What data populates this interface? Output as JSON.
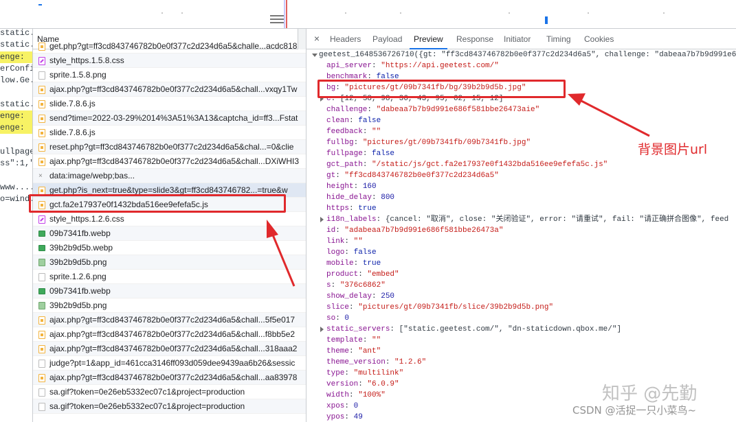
{
  "console": {
    "lines": [
      {
        "text": "static.com/",
        "highlight": false
      },
      {
        "text": "static.ge...",
        "highlight": false
      },
      {
        "text": "enge:",
        "highlight": true
      },
      {
        "text": "erConfi...",
        "highlight": false
      },
      {
        "text": "low.Ge...",
        "highlight": false
      },
      {
        "text": "",
        "highlight": false
      },
      {
        "text": "static.g...",
        "highlight": false
      },
      {
        "text": "enge:",
        "highlight": true
      },
      {
        "text": "enge:",
        "highlight": true
      },
      {
        "text": "",
        "highlight": false
      },
      {
        "text": "ullpage...",
        "highlight": false
      },
      {
        "text": "ss\":1,\"...",
        "highlight": false
      },
      {
        "text": "",
        "highlight": false
      },
      {
        "text": "www....",
        "highlight": false
      },
      {
        "text": "o=wind...",
        "highlight": false
      }
    ]
  },
  "requests": {
    "column_name": "Name",
    "rows": [
      {
        "name": "get.php?gt=ff3cd843746782b0e0f377c2d234d6a5&challe...acdc818",
        "type": "js"
      },
      {
        "name": "style_https.1.5.8.css",
        "type": "css"
      },
      {
        "name": "sprite.1.5.8.png",
        "type": "doc"
      },
      {
        "name": "ajax.php?gt=ff3cd843746782b0e0f377c2d234d6a5&chall...vxqy1Tw",
        "type": "js"
      },
      {
        "name": "slide.7.8.6.js",
        "type": "js"
      },
      {
        "name": "send?time=2022-03-29%2014%3A51%3A13&captcha_id=ff3...Fstat",
        "type": "js"
      },
      {
        "name": "slide.7.8.6.js",
        "type": "js"
      },
      {
        "name": "reset.php?gt=ff3cd843746782b0e0f377c2d234d6a5&chal...=0&clie",
        "type": "js"
      },
      {
        "name": "ajax.php?gt=ff3cd843746782b0e0f377c2d234d6a5&chall...DXiWHI3",
        "type": "js"
      },
      {
        "name": "data:image/webp;bas...",
        "type": "data"
      },
      {
        "name": "get.php?is_next=true&type=slide3&gt=ff3cd843746782...=true&w",
        "type": "js"
      },
      {
        "name": "gct.fa2e17937e0f1432bda516ee9efefa5c.js",
        "type": "js"
      },
      {
        "name": "style_https.1.2.6.css",
        "type": "css"
      },
      {
        "name": "09b7341fb.webp",
        "type": "img"
      },
      {
        "name": "39b2b9d5b.webp",
        "type": "img"
      },
      {
        "name": "39b2b9d5b.png",
        "type": "imgb"
      },
      {
        "name": "sprite.1.2.6.png",
        "type": "doc"
      },
      {
        "name": "09b7341fb.webp",
        "type": "img"
      },
      {
        "name": "39b2b9d5b.png",
        "type": "imgb"
      },
      {
        "name": "ajax.php?gt=ff3cd843746782b0e0f377c2d234d6a5&chall...5f5e017",
        "type": "js"
      },
      {
        "name": "ajax.php?gt=ff3cd843746782b0e0f377c2d234d6a5&chall...f8bb5e2",
        "type": "js"
      },
      {
        "name": "ajax.php?gt=ff3cd843746782b0e0f377c2d234d6a5&chall...318aaa2",
        "type": "js"
      },
      {
        "name": "judge?pt=1&app_id=461cca3146ff093d059dee9439aa6b26&sessic",
        "type": "doc"
      },
      {
        "name": "ajax.php?gt=ff3cd843746782b0e0f377c2d234d6a5&chall...aa83978",
        "type": "js"
      },
      {
        "name": "sa.gif?token=0e26eb5332ec07c1&project=production",
        "type": "doc"
      },
      {
        "name": "sa.gif?token=0e26eb5332ec07c1&project=production",
        "type": "doc"
      }
    ]
  },
  "detail": {
    "close_icon": "×",
    "tabs": [
      "Headers",
      "Payload",
      "Preview",
      "Response",
      "Initiator",
      "Timing",
      "Cookies"
    ],
    "active_tab": "Preview",
    "preview": {
      "root_line": "geetest_1648536726710({gt: \"ff3cd843746782b0e0f377c2d234d6a5\", challenge: \"dabeaa7b7b9d991e6",
      "lines": [
        {
          "key": "api_server",
          "value": "\"https://api.geetest.com/\"",
          "kind": "s",
          "expandable": false
        },
        {
          "key": "benchmark",
          "value": "false",
          "kind": "b",
          "expandable": false
        },
        {
          "key": "bg",
          "value": "\"pictures/gt/09b7341fb/bg/39b2b9d5b.jpg\"",
          "kind": "s",
          "expandable": false
        },
        {
          "key": "c",
          "value": "[12, 58, 98, 36, 43, 95, 62, 15, 12]",
          "kind": "plain",
          "expandable": true
        },
        {
          "key": "challenge",
          "value": "\"dabeaa7b7b9d991e686f581bbe26473aie\"",
          "kind": "s",
          "expandable": false
        },
        {
          "key": "clean",
          "value": "false",
          "kind": "b",
          "expandable": false
        },
        {
          "key": "feedback",
          "value": "\"\"",
          "kind": "s",
          "expandable": false
        },
        {
          "key": "fullbg",
          "value": "\"pictures/gt/09b7341fb/09b7341fb.jpg\"",
          "kind": "s",
          "expandable": false
        },
        {
          "key": "fullpage",
          "value": "false",
          "kind": "b",
          "expandable": false
        },
        {
          "key": "gct_path",
          "value": "\"/static/js/gct.fa2e17937e0f1432bda516ee9efefa5c.js\"",
          "kind": "s",
          "expandable": false
        },
        {
          "key": "gt",
          "value": "\"ff3cd843746782b0e0f377c2d234d6a5\"",
          "kind": "s",
          "expandable": false
        },
        {
          "key": "height",
          "value": "160",
          "kind": "n",
          "expandable": false
        },
        {
          "key": "hide_delay",
          "value": "800",
          "kind": "n",
          "expandable": false
        },
        {
          "key": "https",
          "value": "true",
          "kind": "b",
          "expandable": false
        },
        {
          "key": "i18n_labels",
          "value": "{cancel: \"取消\", close: \"关闭验证\", error: \"请重试\", fail: \"请正确拼合图像\", feed",
          "kind": "plain",
          "expandable": true
        },
        {
          "key": "id",
          "value": "\"adabeaa7b7b9d991e686f581bbe26473a\"",
          "kind": "s",
          "expandable": false
        },
        {
          "key": "link",
          "value": "\"\"",
          "kind": "s",
          "expandable": false
        },
        {
          "key": "logo",
          "value": "false",
          "kind": "b",
          "expandable": false
        },
        {
          "key": "mobile",
          "value": "true",
          "kind": "b",
          "expandable": false
        },
        {
          "key": "product",
          "value": "\"embed\"",
          "kind": "s",
          "expandable": false
        },
        {
          "key": "s",
          "value": "\"376c6862\"",
          "kind": "s",
          "expandable": false
        },
        {
          "key": "show_delay",
          "value": "250",
          "kind": "n",
          "expandable": false
        },
        {
          "key": "slice",
          "value": "\"pictures/gt/09b7341fb/slice/39b2b9d5b.png\"",
          "kind": "s",
          "expandable": false
        },
        {
          "key": "so",
          "value": "0",
          "kind": "n",
          "expandable": false
        },
        {
          "key": "static_servers",
          "value": "[\"static.geetest.com/\", \"dn-staticdown.qbox.me/\"]",
          "kind": "plain",
          "expandable": true
        },
        {
          "key": "template",
          "value": "\"\"",
          "kind": "s",
          "expandable": false
        },
        {
          "key": "theme",
          "value": "\"ant\"",
          "kind": "s",
          "expandable": false
        },
        {
          "key": "theme_version",
          "value": "\"1.2.6\"",
          "kind": "s",
          "expandable": false
        },
        {
          "key": "type",
          "value": "\"multilink\"",
          "kind": "s",
          "expandable": false
        },
        {
          "key": "version",
          "value": "\"6.0.9\"",
          "kind": "s",
          "expandable": false
        },
        {
          "key": "width",
          "value": "\"100%\"",
          "kind": "s",
          "expandable": false
        },
        {
          "key": "xpos",
          "value": "0",
          "kind": "n",
          "expandable": false
        },
        {
          "key": "ypos",
          "value": "49",
          "kind": "n",
          "expandable": false
        }
      ]
    }
  },
  "annotation": {
    "label": "背景图片url",
    "color": "#e0292c"
  },
  "watermark": {
    "site": "知乎 @先勤",
    "csdn": "CSDN @活捉一只小菜鸟~"
  },
  "icons": {
    "close": "close-icon",
    "expand": "triangle-right-icon",
    "collapse": "triangle-down-icon",
    "file_js": "script-file-icon",
    "file_css": "stylesheet-file-icon",
    "file_img": "image-file-icon",
    "file_doc": "document-file-icon"
  }
}
